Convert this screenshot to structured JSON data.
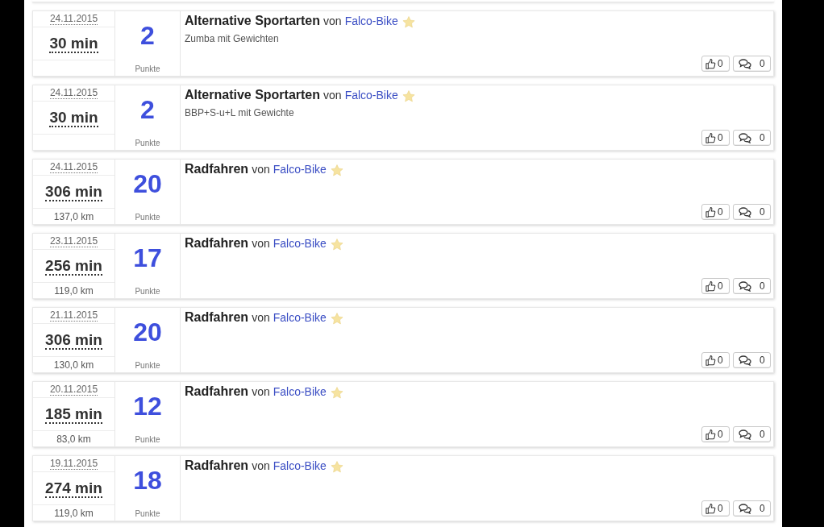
{
  "activities": [
    {
      "date": "24.11.2015",
      "duration": "30 min",
      "points": "2",
      "points_label": "Punkte",
      "sport": "Alternative Sportarten",
      "by": "von",
      "user": "Falco-Bike",
      "description": "Zumba mit Gewichten",
      "likes": "0",
      "comments": "0"
    },
    {
      "date": "24.11.2015",
      "duration": "30 min",
      "points": "2",
      "points_label": "Punkte",
      "sport": "Alternative Sportarten",
      "by": "von",
      "user": "Falco-Bike",
      "description": "BBP+S-u+L mit Gewichte",
      "likes": "0",
      "comments": "0"
    },
    {
      "date": "24.11.2015",
      "duration": "306 min",
      "distance": "137,0 km",
      "points": "20",
      "points_label": "Punkte",
      "sport": "Radfahren",
      "by": "von",
      "user": "Falco-Bike",
      "likes": "0",
      "comments": "0"
    },
    {
      "date": "23.11.2015",
      "duration": "256 min",
      "distance": "119,0 km",
      "points": "17",
      "points_label": "Punkte",
      "sport": "Radfahren",
      "by": "von",
      "user": "Falco-Bike",
      "likes": "0",
      "comments": "0"
    },
    {
      "date": "21.11.2015",
      "duration": "306 min",
      "distance": "130,0 km",
      "points": "20",
      "points_label": "Punkte",
      "sport": "Radfahren",
      "by": "von",
      "user": "Falco-Bike",
      "likes": "0",
      "comments": "0"
    },
    {
      "date": "20.11.2015",
      "duration": "185 min",
      "distance": "83,0 km",
      "points": "12",
      "points_label": "Punkte",
      "sport": "Radfahren",
      "by": "von",
      "user": "Falco-Bike",
      "likes": "0",
      "comments": "0"
    },
    {
      "date": "19.11.2015",
      "duration": "274 min",
      "distance": "119,0 km",
      "points": "18",
      "points_label": "Punkte",
      "sport": "Radfahren",
      "by": "von",
      "user": "Falco-Bike",
      "likes": "0",
      "comments": "0"
    }
  ]
}
